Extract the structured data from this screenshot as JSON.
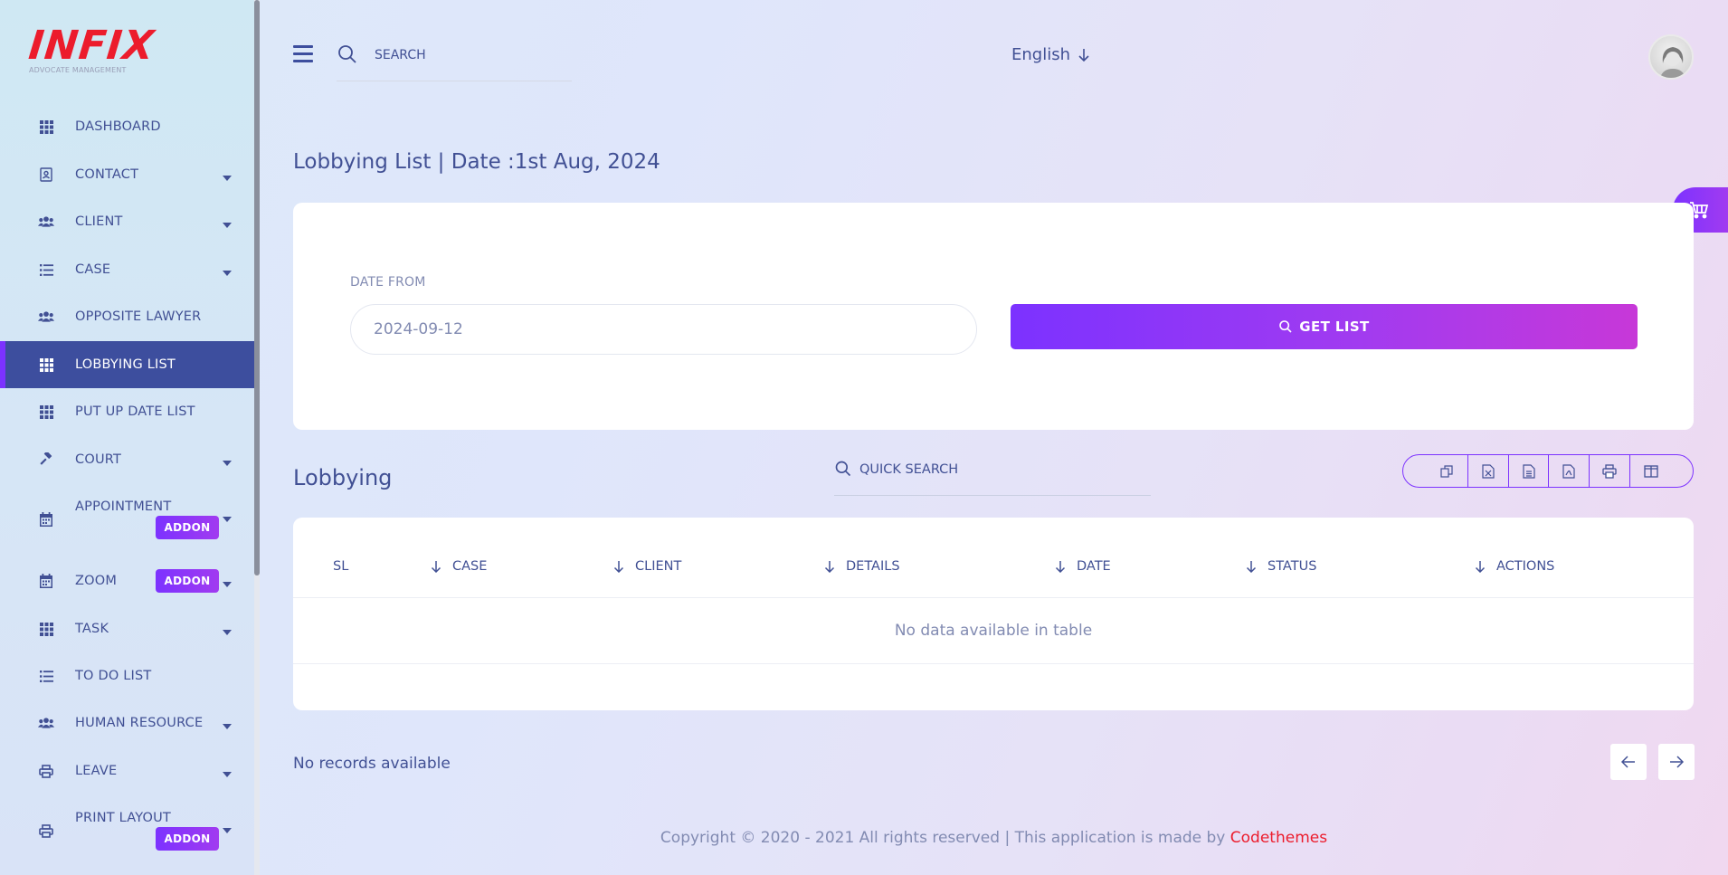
{
  "brand": {
    "logo_text": "INFIX",
    "logo_subtitle": "ADVOCATE MANAGEMENT"
  },
  "sidebar": {
    "items": [
      {
        "label": "DASHBOARD",
        "icon": "grid-icon",
        "caret": false,
        "addon": ""
      },
      {
        "label": "CONTACT",
        "icon": "contact-book-icon",
        "caret": true,
        "addon": ""
      },
      {
        "label": "CLIENT",
        "icon": "users-icon",
        "caret": true,
        "addon": ""
      },
      {
        "label": "CASE",
        "icon": "list-icon",
        "caret": true,
        "addon": ""
      },
      {
        "label": "OPPOSITE LAWYER",
        "icon": "users-icon",
        "caret": false,
        "addon": ""
      },
      {
        "label": "LOBBYING LIST",
        "icon": "grid-icon",
        "caret": false,
        "addon": "",
        "active": true
      },
      {
        "label": "PUT UP DATE LIST",
        "icon": "grid-icon",
        "caret": false,
        "addon": ""
      },
      {
        "label": "COURT",
        "icon": "gavel-icon",
        "caret": true,
        "addon": ""
      },
      {
        "label": "APPOINTMENT",
        "icon": "calendar-icon",
        "caret": true,
        "addon": "ADDON"
      },
      {
        "label": "ZOOM",
        "icon": "calendar-icon",
        "caret": true,
        "addon": "ADDON"
      },
      {
        "label": "TASK",
        "icon": "grid-icon",
        "caret": true,
        "addon": ""
      },
      {
        "label": "TO DO LIST",
        "icon": "list-icon",
        "caret": false,
        "addon": ""
      },
      {
        "label": "HUMAN RESOURCE",
        "icon": "users-icon",
        "caret": true,
        "addon": ""
      },
      {
        "label": "LEAVE",
        "icon": "printer-icon",
        "caret": true,
        "addon": ""
      },
      {
        "label": "PRINT LAYOUT",
        "icon": "printer-icon",
        "caret": true,
        "addon": "ADDON"
      }
    ]
  },
  "header": {
    "search_placeholder": "SEARCH",
    "language": "English"
  },
  "page": {
    "title": "Lobbying List | Date :1st Aug, 2024"
  },
  "filter": {
    "date_from_label": "DATE FROM",
    "date_from_value": "2024-09-12",
    "get_list_label": "GET LIST"
  },
  "table": {
    "section_title": "Lobbying",
    "quick_search_placeholder": "QUICK SEARCH",
    "export_buttons": [
      "copy-icon",
      "excel-icon",
      "csv-icon",
      "pdf-icon",
      "print-icon",
      "columns-icon"
    ],
    "columns": [
      "SL",
      "CASE",
      "CLIENT",
      "DETAILS",
      "DATE",
      "STATUS",
      "ACTIONS"
    ],
    "empty_message": "No data available in table",
    "records_text": "No records available"
  },
  "footer": {
    "text": "Copyright © 2020 - 2021 All rights reserved | This application is made by ",
    "brand": "Codethemes"
  },
  "colors": {
    "primary": "#415094",
    "accent": "#7c32ff",
    "brand_red": "#ec1c2c",
    "active_nav": "#3d4e9e"
  }
}
